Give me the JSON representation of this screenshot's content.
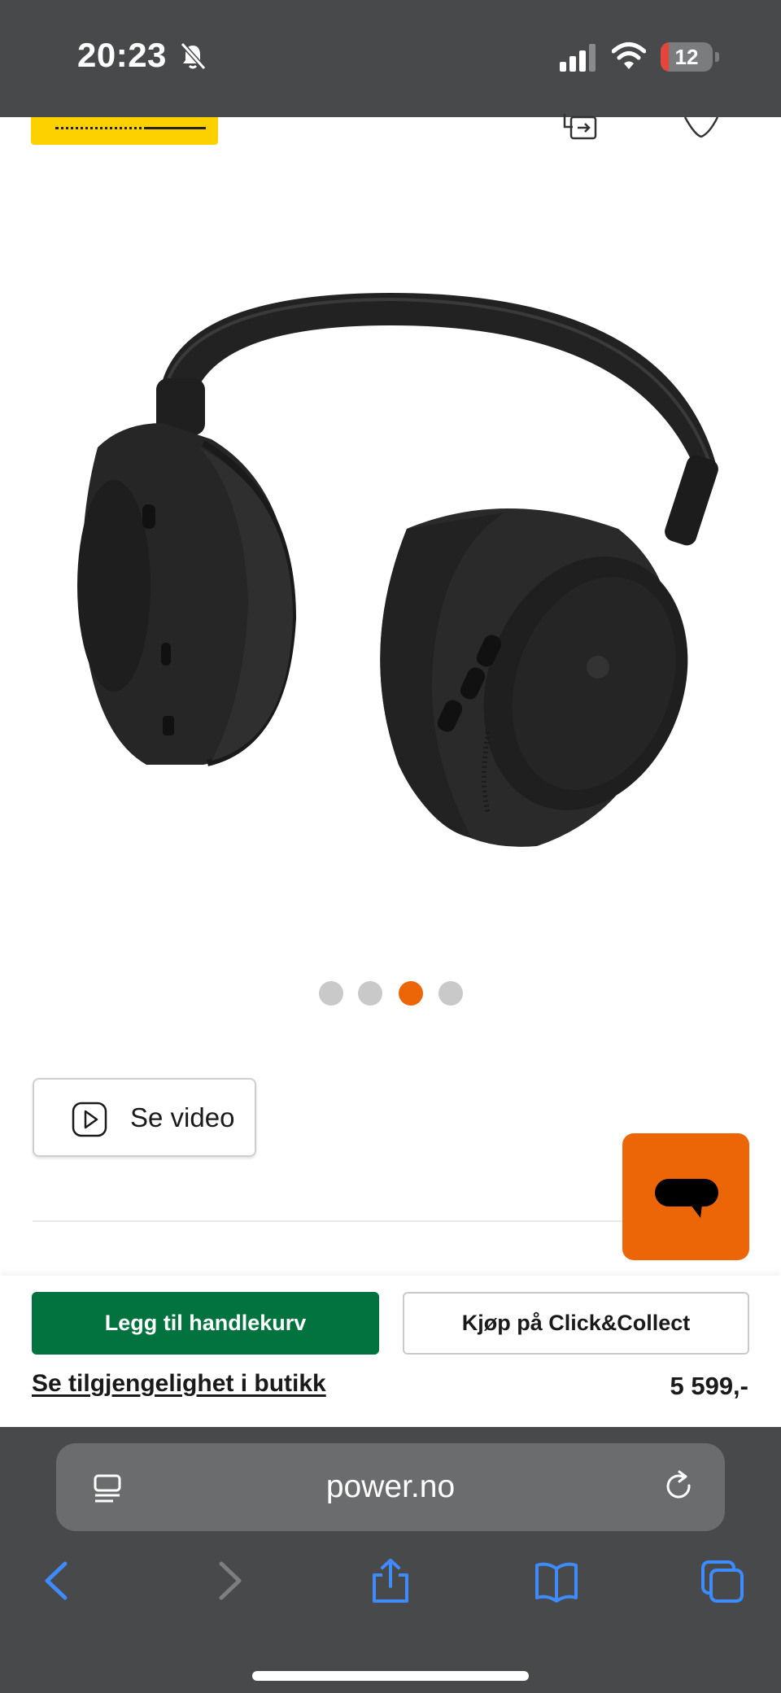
{
  "status_bar": {
    "time": "20:23",
    "battery_level": "12",
    "icons": [
      "bell-slash-icon",
      "cellular-signal-icon",
      "wifi-icon",
      "battery-icon"
    ]
  },
  "page_header": {
    "icons": [
      "compare-icon",
      "heart-icon"
    ],
    "brand_color": "#fdd000"
  },
  "gallery": {
    "image_subject": "headphones",
    "dot_count": 4,
    "active_index": 2,
    "active_color": "#ec6608",
    "inactive_color": "#c9c9c9"
  },
  "video": {
    "label": "Se video",
    "icon": "play-icon"
  },
  "chat": {
    "icon": "chat-bubble-icon",
    "color": "#ec6608"
  },
  "buy_bar": {
    "add_to_cart_label": "Legg til handlekurv",
    "click_collect_label": "Kjøp på Click&Collect",
    "availability_label": "Se tilgjengelighet i butikk",
    "price": "5 599,-",
    "primary_color": "#02733e"
  },
  "browser": {
    "url": "power.no",
    "toolbar_icons": [
      "back-icon",
      "forward-icon",
      "share-icon",
      "bookmarks-icon",
      "tabs-icon"
    ],
    "accent": "#3d8bfd"
  }
}
